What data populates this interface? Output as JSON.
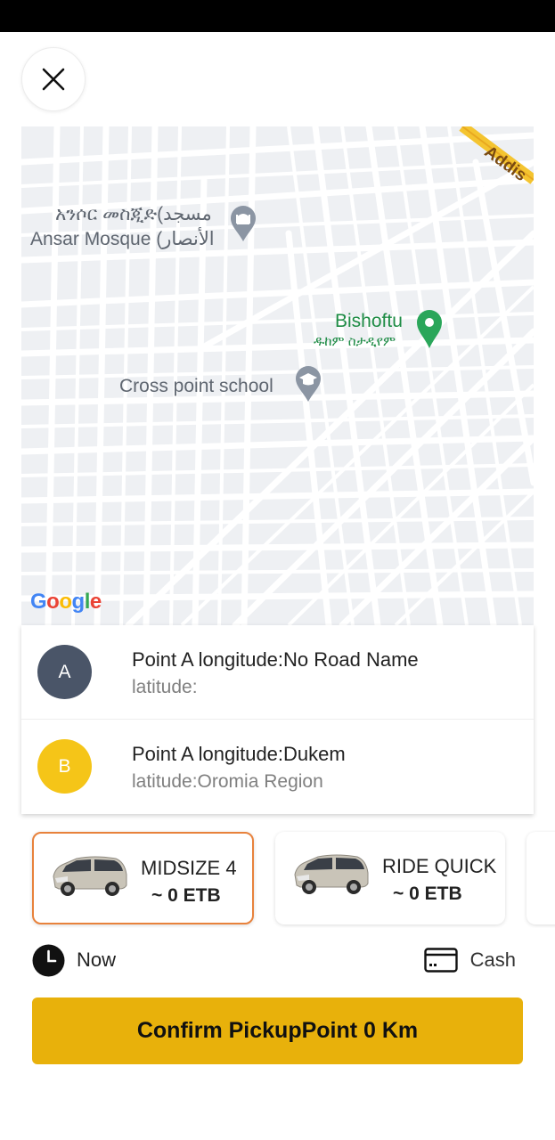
{
  "colors": {
    "accent": "#e8b10b",
    "selected_border": "#e8823c",
    "badge_a": "#4a5568",
    "badge_b": "#f5c518",
    "map_background": "#eef0f3",
    "place_green": "#1e8c45"
  },
  "header": {
    "close_icon": "close-icon"
  },
  "map": {
    "labels": {
      "mosque_line1": "አንሶር መስጂድ(مسجد",
      "mosque_line2": "Ansar Mosque (الأنصار",
      "bishoftu": "Bishoftu",
      "bishoftu_amharic": "ዱከም ስታዲየም",
      "school": "Cross point school",
      "addis": "Addis"
    },
    "google_logo": {
      "letters": [
        "G",
        "o",
        "o",
        "g",
        "l",
        "e"
      ],
      "colors": [
        "#4285F4",
        "#EA4335",
        "#FBBC05",
        "#4285F4",
        "#34A853",
        "#EA4335"
      ]
    }
  },
  "points": [
    {
      "badge": "A",
      "title": "Point A longitude:No Road Name",
      "subtitle": "latitude:"
    },
    {
      "badge": "B",
      "title": "Point A longitude:Dukem",
      "subtitle": "latitude:Oromia Region"
    }
  ],
  "vehicles": [
    {
      "name": "MIDSIZE 4",
      "price": "~ 0 ETB",
      "selected": true
    },
    {
      "name": "RIDE QUICK",
      "price": "~ 0 ETB",
      "selected": false
    }
  ],
  "schedule": {
    "label": "Now",
    "icon": "clock-icon"
  },
  "payment": {
    "label": "Cash",
    "icon": "credit-card-icon"
  },
  "confirm_button": {
    "label": "Confirm PickupPoint 0 Km"
  }
}
